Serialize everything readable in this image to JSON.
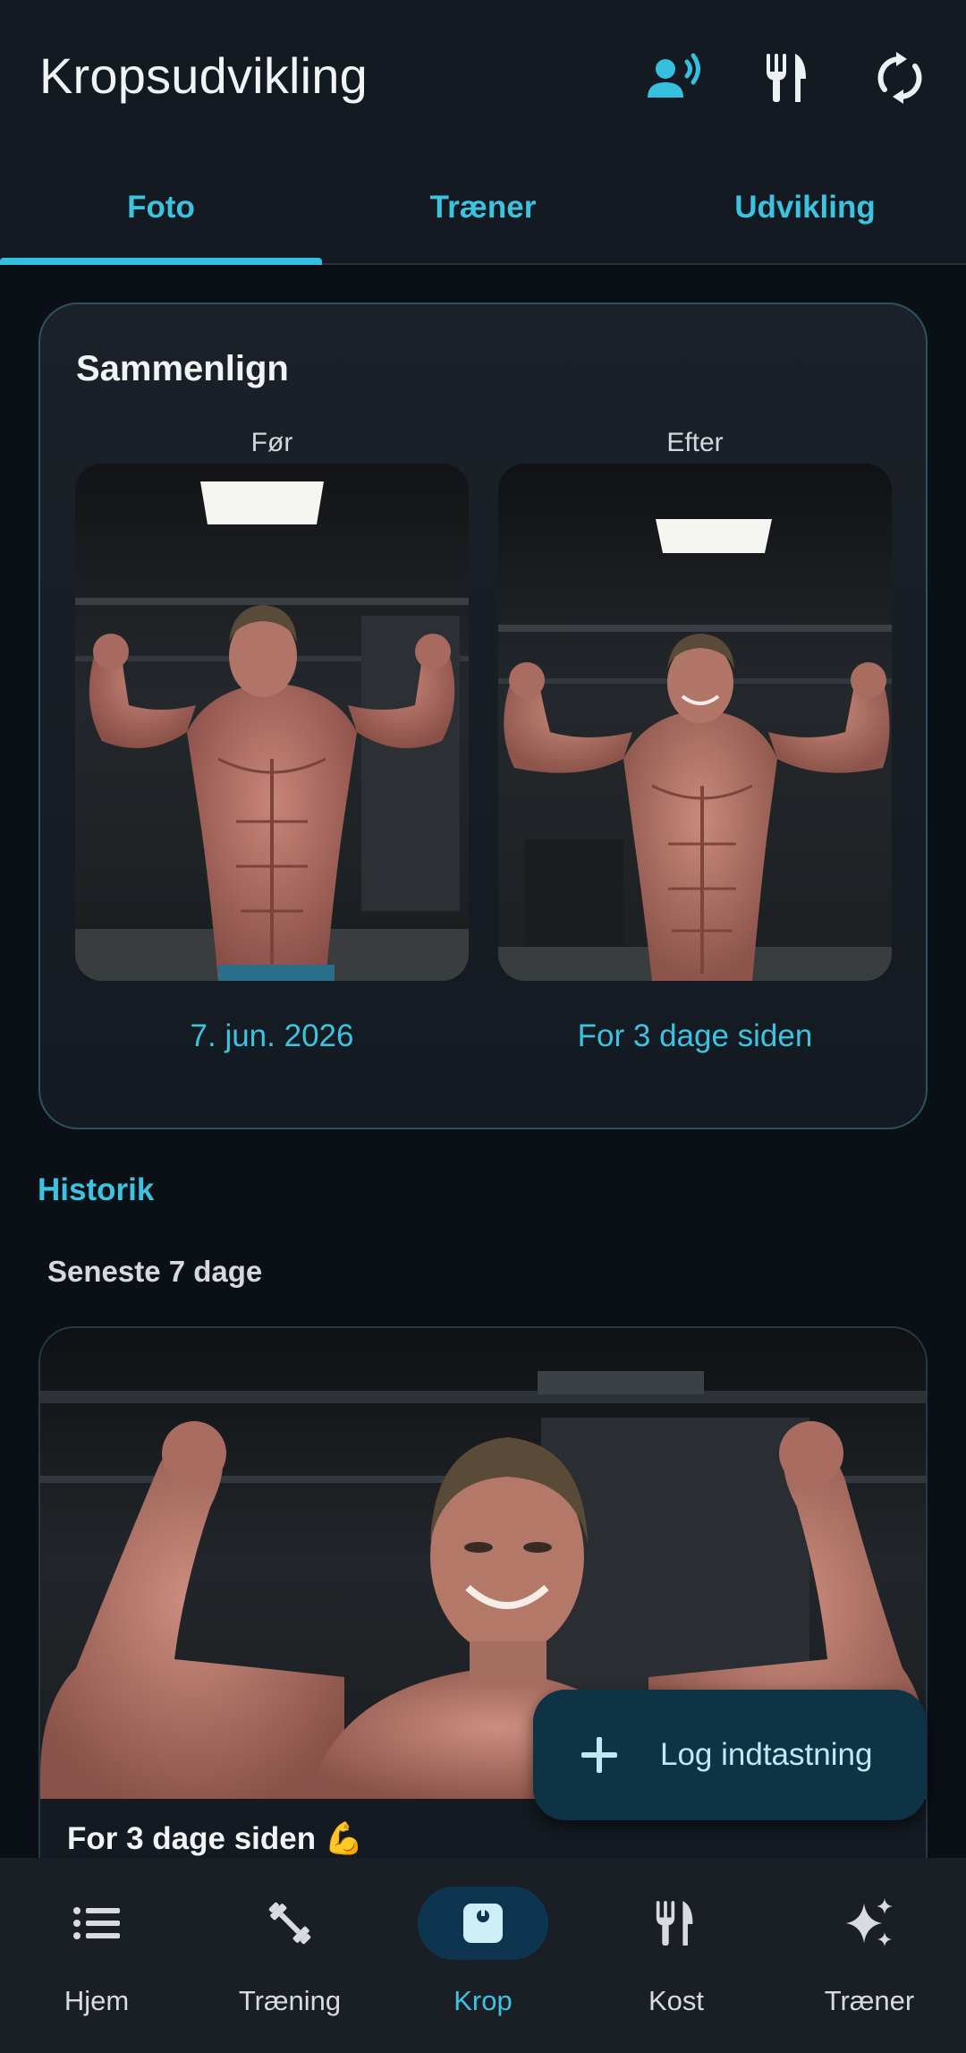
{
  "app_bar": {
    "title": "Kropsudvikling",
    "icons": [
      "voice-assistant-icon",
      "restaurant-icon",
      "sync-icon"
    ]
  },
  "tabs": [
    {
      "label": "Foto",
      "active": true
    },
    {
      "label": "Træner",
      "active": false
    },
    {
      "label": "Udvikling",
      "active": false
    }
  ],
  "compare": {
    "title": "Sammenlign",
    "before_label": "Før",
    "after_label": "Efter",
    "before_date": "7. jun. 2026",
    "after_date": "For 3 dage siden"
  },
  "history": {
    "section_title": "Historik",
    "group_title": "Seneste 7 dage",
    "entries": [
      {
        "caption": "For 3 dage siden 💪"
      }
    ]
  },
  "fab": {
    "label": "Log indtastning"
  },
  "bottom_nav": [
    {
      "label": "Hjem",
      "icon": "list-icon",
      "active": false
    },
    {
      "label": "Træning",
      "icon": "dumbbell-icon",
      "active": false
    },
    {
      "label": "Krop",
      "icon": "scale-icon",
      "active": true
    },
    {
      "label": "Kost",
      "icon": "restaurant-icon",
      "active": false
    },
    {
      "label": "Træner",
      "icon": "sparkles-icon",
      "active": false
    }
  ],
  "colors": {
    "accent": "#3cc3e0",
    "background": "#0b1016",
    "surface": "#131a22",
    "active_nav_pill": "#0e3550",
    "fab_background": "#0d3344"
  }
}
